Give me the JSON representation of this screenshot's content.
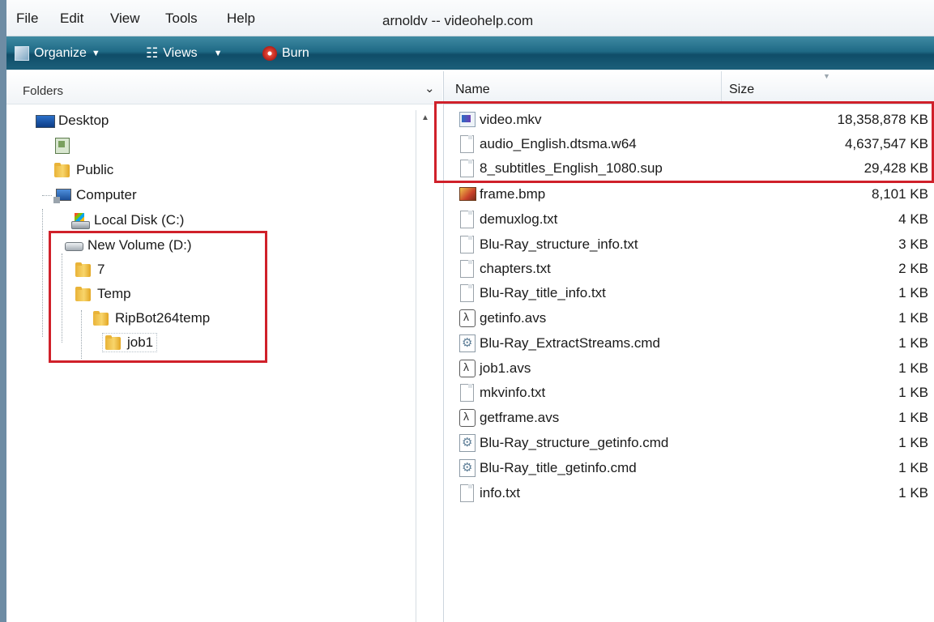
{
  "menu": {
    "items": [
      "File",
      "Edit",
      "View",
      "Tools",
      "Help"
    ],
    "title": "arnoldv -- videohelp.com"
  },
  "toolbar": {
    "organize": "Organize",
    "views": "Views",
    "burn": "Burn"
  },
  "folders": {
    "header": "Folders",
    "tree": [
      {
        "label": "Desktop",
        "icon": "desktop-icon"
      },
      {
        "label": "",
        "icon": "user-folder-icon"
      },
      {
        "label": "Public",
        "icon": "folder-icon"
      },
      {
        "label": "Computer",
        "icon": "computer-icon"
      },
      {
        "label": "Local Disk (C:)",
        "icon": "local-disk-icon"
      },
      {
        "label": "New Volume (D:)",
        "icon": "volume-icon"
      },
      {
        "label": "7",
        "icon": "folder-icon"
      },
      {
        "label": "Temp",
        "icon": "folder-icon"
      },
      {
        "label": "RipBot264temp",
        "icon": "folder-icon"
      },
      {
        "label": "job1",
        "icon": "folder-icon"
      }
    ]
  },
  "files": {
    "columns": {
      "name": "Name",
      "size": "Size"
    },
    "rows": [
      {
        "name": "video.mkv",
        "size": "18,358,878 KB",
        "icon": "media-file-icon"
      },
      {
        "name": "audio_English.dtsma.w64",
        "size": "4,637,547 KB",
        "icon": "document-icon"
      },
      {
        "name": "8_subtitles_English_1080.sup",
        "size": "29,428 KB",
        "icon": "document-icon"
      },
      {
        "name": "frame.bmp",
        "size": "8,101 KB",
        "icon": "bitmap-icon"
      },
      {
        "name": "demuxlog.txt",
        "size": "4 KB",
        "icon": "document-icon"
      },
      {
        "name": "Blu-Ray_structure_info.txt",
        "size": "3 KB",
        "icon": "document-icon"
      },
      {
        "name": "chapters.txt",
        "size": "2 KB",
        "icon": "document-icon"
      },
      {
        "name": "Blu-Ray_title_info.txt",
        "size": "1 KB",
        "icon": "document-icon"
      },
      {
        "name": "getinfo.avs",
        "size": "1 KB",
        "icon": "avisynth-script-icon"
      },
      {
        "name": "Blu-Ray_ExtractStreams.cmd",
        "size": "1 KB",
        "icon": "cmd-script-icon"
      },
      {
        "name": "job1.avs",
        "size": "1 KB",
        "icon": "avisynth-script-icon"
      },
      {
        "name": "mkvinfo.txt",
        "size": "1 KB",
        "icon": "document-icon"
      },
      {
        "name": "getframe.avs",
        "size": "1 KB",
        "icon": "avisynth-script-icon"
      },
      {
        "name": "Blu-Ray_structure_getinfo.cmd",
        "size": "1 KB",
        "icon": "cmd-script-icon"
      },
      {
        "name": "Blu-Ray_title_getinfo.cmd",
        "size": "1 KB",
        "icon": "cmd-script-icon"
      },
      {
        "name": "info.txt",
        "size": "1 KB",
        "icon": "document-icon"
      }
    ]
  },
  "colors": {
    "highlight": "#d0202a",
    "toolbar": "#1f6a86"
  }
}
